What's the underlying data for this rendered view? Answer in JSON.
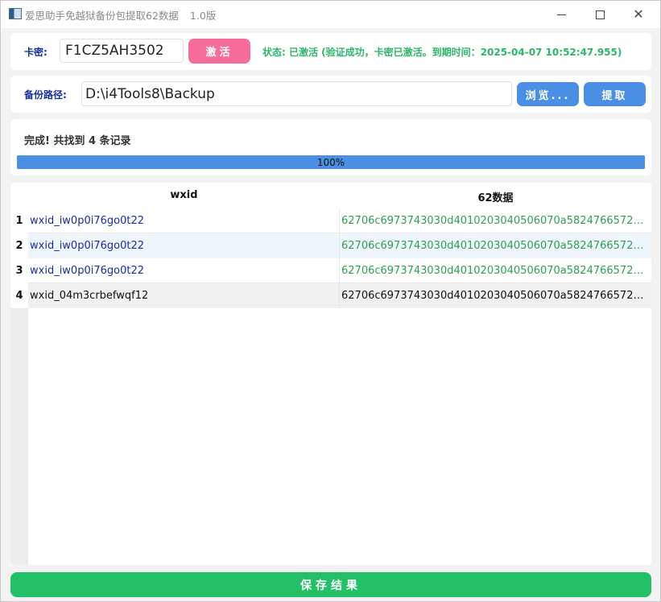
{
  "window": {
    "title": "爱思助手免越狱备份包提取62数据",
    "version": "1.0版",
    "icons": {
      "minimize": "minimize-icon",
      "maximize": "maximize-icon",
      "close": "close-icon"
    }
  },
  "activation": {
    "label": "卡密:",
    "key_value": "F1CZ5AH3502",
    "button_label": "激活",
    "status": "状态: 已激活 (验证成功，卡密已激活。到期时间：2025-04-07 10:52:47.955)"
  },
  "backup": {
    "label": "备份路径:",
    "path_value": "D:\\i4Tools8\\Backup",
    "browse_label": "浏览...",
    "extract_label": "提取"
  },
  "progress": {
    "message": "完成! 共找到 4 条记录",
    "percent": 100,
    "label": "100%"
  },
  "table": {
    "columns": [
      "wxid",
      "62数据"
    ],
    "rows": [
      {
        "index": "1",
        "wxid": "wxid_iw0p0i76go0t22",
        "data62": "62706c6973743030d4010203040506070a58247665727..."
      },
      {
        "index": "2",
        "wxid": "wxid_iw0p0i76go0t22",
        "data62": "62706c6973743030d4010203040506070a58247665727..."
      },
      {
        "index": "3",
        "wxid": "wxid_iw0p0i76go0t22",
        "data62": "62706c6973743030d4010203040506070a58247665727..."
      },
      {
        "index": "4",
        "wxid": "wxid_04m3crbefwqf12",
        "data62": "62706c6973743030d4010203040506070a58247665727..."
      }
    ]
  },
  "save_label": "保存结果",
  "colors": {
    "label_blue": "#1a2e9c",
    "status_green": "#2eb56a",
    "activate_pink": "#f66d9b",
    "button_blue": "#4a8fe3",
    "save_green": "#23c067"
  }
}
